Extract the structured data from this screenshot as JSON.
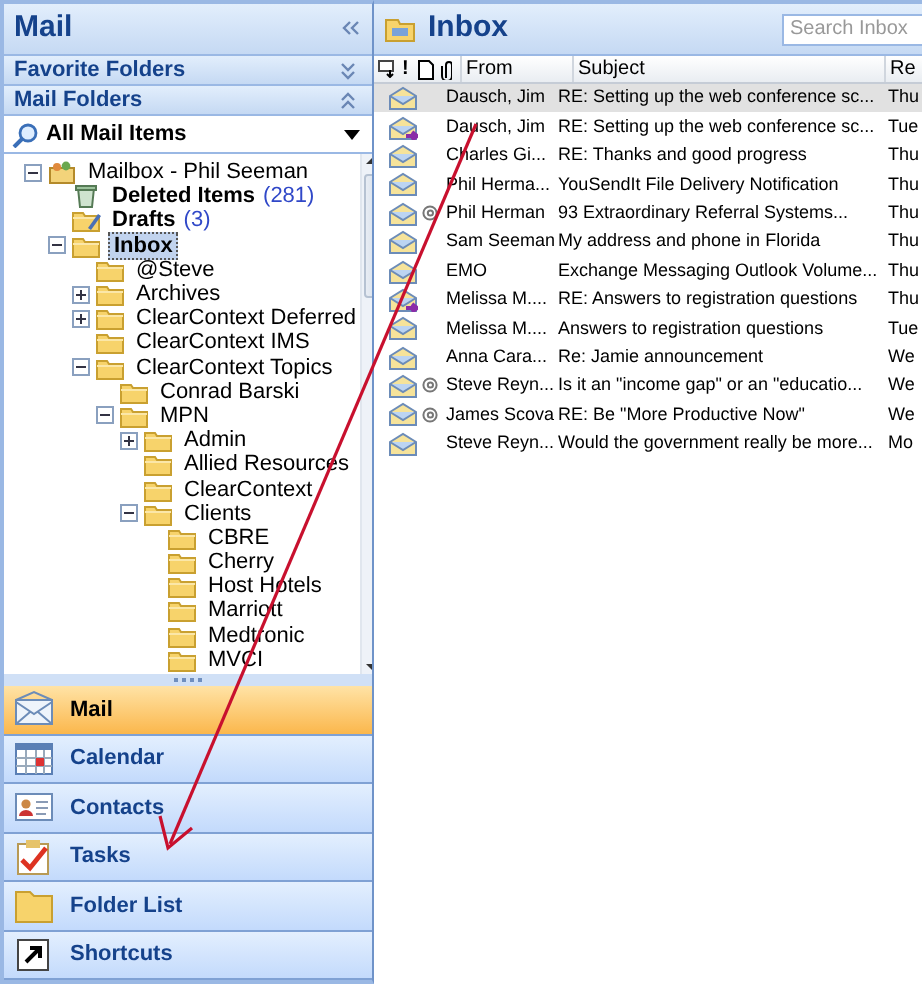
{
  "left_pane": {
    "title": "Mail",
    "sections": [
      {
        "label": "Favorite Folders",
        "expanded": false
      },
      {
        "label": "Mail Folders",
        "expanded": true
      }
    ],
    "view_selector": {
      "label": "All Mail Items"
    },
    "folder_tree": [
      {
        "label": "Mailbox - Phil Seeman",
        "kind": "mailbox",
        "expanded": true,
        "selected": false,
        "unread": false,
        "children": [
          {
            "label": "Deleted Items",
            "kind": "deleted",
            "count": "(281)",
            "selected": false,
            "unread": true
          },
          {
            "label": "Drafts",
            "kind": "drafts",
            "count": "(3)",
            "selected": false,
            "unread": true
          },
          {
            "label": "Inbox",
            "kind": "folder",
            "expanded": true,
            "selected": true,
            "unread": false,
            "children": [
              {
                "label": "@Steve",
                "kind": "folder",
                "selected": false,
                "unread": false
              },
              {
                "label": "Archives",
                "kind": "folder",
                "expanded": false,
                "selected": false,
                "unread": false
              },
              {
                "label": "ClearContext Deferred",
                "kind": "folder",
                "expanded": false,
                "selected": false,
                "unread": false
              },
              {
                "label": "ClearContext IMS",
                "kind": "folder",
                "selected": false,
                "unread": false
              },
              {
                "label": "ClearContext Topics",
                "kind": "folder",
                "expanded": true,
                "selected": false,
                "unread": false,
                "children": [
                  {
                    "label": "Conrad Barski",
                    "kind": "folder",
                    "selected": false,
                    "unread": false
                  },
                  {
                    "label": "MPN",
                    "kind": "folder",
                    "expanded": true,
                    "selected": false,
                    "unread": false,
                    "children": [
                      {
                        "label": "Admin",
                        "kind": "folder",
                        "expanded": false,
                        "selected": false,
                        "unread": false
                      },
                      {
                        "label": "Allied Resources",
                        "kind": "folder",
                        "selected": false,
                        "unread": false
                      },
                      {
                        "label": "ClearContext",
                        "kind": "folder",
                        "selected": false,
                        "unread": false
                      },
                      {
                        "label": "Clients",
                        "kind": "folder",
                        "expanded": true,
                        "selected": false,
                        "unread": false,
                        "children": [
                          {
                            "label": "CBRE",
                            "kind": "folder",
                            "selected": false,
                            "unread": false
                          },
                          {
                            "label": "Cherry",
                            "kind": "folder",
                            "selected": false,
                            "unread": false
                          },
                          {
                            "label": "Host Hotels",
                            "kind": "folder",
                            "selected": false,
                            "unread": false
                          },
                          {
                            "label": "Marriott",
                            "kind": "folder",
                            "selected": false,
                            "unread": false
                          },
                          {
                            "label": "Medtronic",
                            "kind": "folder",
                            "selected": false,
                            "unread": false
                          },
                          {
                            "label": "MVCI",
                            "kind": "folder",
                            "selected": false,
                            "unread": false
                          }
                        ]
                      }
                    ]
                  }
                ]
              }
            ]
          }
        ]
      }
    ]
  },
  "nav_buttons": [
    {
      "label": "Mail",
      "kind": "mail",
      "selected": true
    },
    {
      "label": "Calendar",
      "kind": "calendar",
      "selected": false
    },
    {
      "label": "Contacts",
      "kind": "contacts",
      "selected": false
    },
    {
      "label": "Tasks",
      "kind": "tasks",
      "selected": false
    },
    {
      "label": "Folder List",
      "kind": "folder",
      "selected": false
    },
    {
      "label": "Shortcuts",
      "kind": "shortcut",
      "selected": false
    }
  ],
  "inbox": {
    "title": "Inbox",
    "search": {
      "placeholder": "Search Inbox"
    },
    "columns": [
      "!",
      "From",
      "Subject",
      "Re"
    ],
    "rows": [
      {
        "from": "Dausch, Jim",
        "subject": "RE: Setting up the web conference sc...",
        "received": "Thu",
        "kind": "read",
        "attachment": false,
        "selected": true
      },
      {
        "from": "Dausch, Jim",
        "subject": "RE: Setting up the web conference sc...",
        "received": "Tue",
        "kind": "replied",
        "attachment": false,
        "selected": false
      },
      {
        "from": "Charles Gi...",
        "subject": "RE: Thanks and good progress",
        "received": "Thu",
        "kind": "read",
        "attachment": false,
        "selected": false
      },
      {
        "from": "Phil Herma...",
        "subject": "YouSendIt File Delivery Notification",
        "received": "Thu",
        "kind": "read",
        "attachment": false,
        "selected": false
      },
      {
        "from": "Phil Herman",
        "subject": "93 Extraordinary Referral Systems...",
        "received": "Thu",
        "kind": "read",
        "attachment": true,
        "selected": false
      },
      {
        "from": "Sam Seeman",
        "subject": "My address and phone in Florida",
        "received": "Thu",
        "kind": "read",
        "attachment": false,
        "selected": false
      },
      {
        "from": "EMO",
        "subject": "Exchange Messaging Outlook Volume...",
        "received": "Thu",
        "kind": "read",
        "attachment": false,
        "selected": false
      },
      {
        "from": "Melissa M....",
        "subject": "RE: Answers to registration questions",
        "received": "Thu",
        "kind": "replied",
        "attachment": false,
        "selected": false
      },
      {
        "from": "Melissa M....",
        "subject": "Answers to registration questions",
        "received": "Tue",
        "kind": "read",
        "attachment": false,
        "selected": false
      },
      {
        "from": "Anna Cara...",
        "subject": "Re: Jamie announcement",
        "received": "We",
        "kind": "read",
        "attachment": false,
        "selected": false
      },
      {
        "from": "Steve Reyn...",
        "subject": "Is it an \"income gap\" or an \"educatio...",
        "received": "We",
        "kind": "read",
        "attachment": true,
        "selected": false
      },
      {
        "from": "James Scova",
        "subject": "RE: Be \"More Productive Now\"",
        "received": "We",
        "kind": "read",
        "attachment": true,
        "selected": false
      },
      {
        "from": "Steve Reyn...",
        "subject": "Would the government really be more...",
        "received": "Mo",
        "kind": "read",
        "attachment": false,
        "selected": false
      }
    ]
  }
}
